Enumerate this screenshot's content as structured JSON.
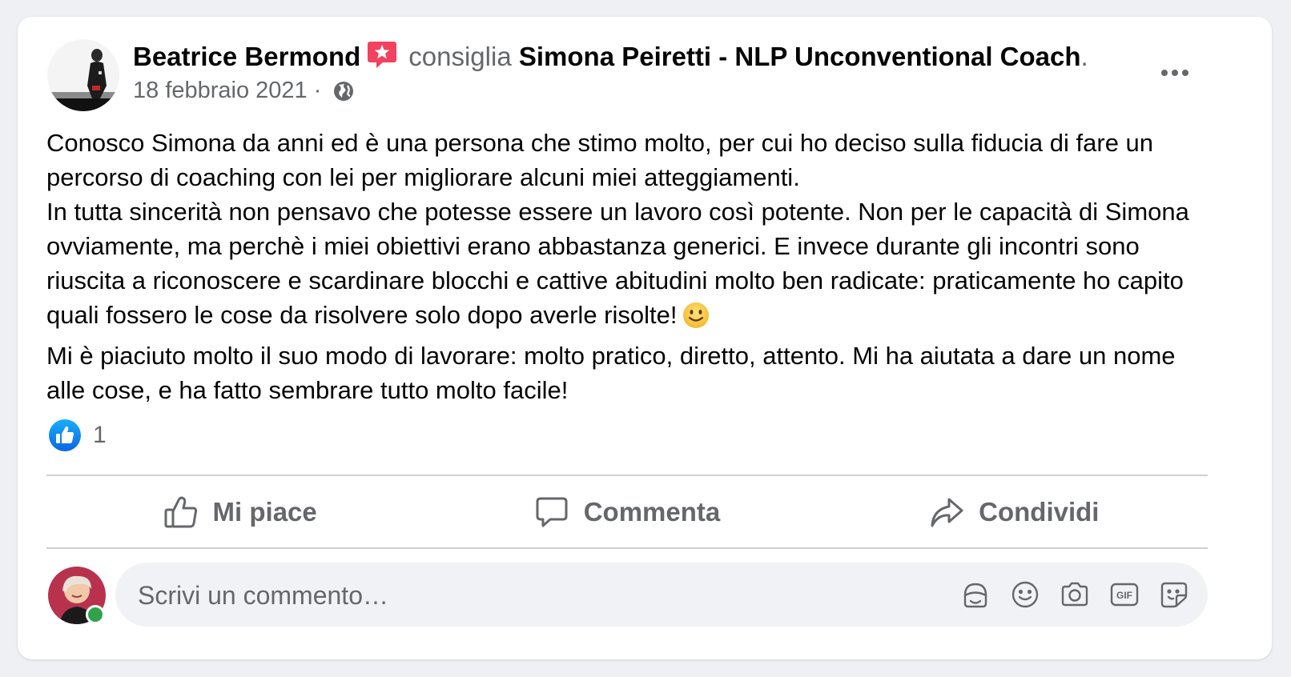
{
  "post": {
    "author": "Beatrice Bermond",
    "verb": "consiglia",
    "page": "Simona Peiretti - NLP Unconventional Coach",
    "page_suffix": ".",
    "date": "18 febbraio 2021",
    "date_separator": " · ",
    "audience_icon": "globe-icon",
    "more_icon": "more-options-icon",
    "text_paragraphs": [
      "Conosco Simona da anni ed è una persona che stimo molto, per cui ho deciso sulla fiducia di fare un percorso di coaching con lei per migliorare alcuni miei atteggiamenti.",
      "In tutta sincerità non pensavo che potesse essere un lavoro così potente. Non per le capacità di Simona ovviamente, ma perchè i miei obiettivi erano abbastanza generici. E invece durante gli incontri sono riuscita a riconoscere e scardinare blocchi e cattive abitudini molto ben radicate: praticamente ho capito quali fossero le cose da risolvere solo dopo averle risolte!",
      "Mi è piaciuto molto il suo modo di lavorare: molto pratico, diretto, attento. Mi ha aiutata a dare un nome alle cose, e ha fatto sembrare tutto molto facile!"
    ],
    "reaction_count": "1"
  },
  "actions": {
    "like_label": "Mi piace",
    "comment_label": "Commenta",
    "share_label": "Condividi"
  },
  "comment": {
    "placeholder": "Scrivi un commento…",
    "icons": [
      "avatar-sticker-icon",
      "emoji-icon",
      "camera-icon",
      "gif-icon",
      "sticker-icon"
    ]
  },
  "colors": {
    "secondary_text": "#65676b",
    "like_blue": "#1877f2",
    "recommend_badge": "#f3425f",
    "online_green": "#31a24c"
  }
}
